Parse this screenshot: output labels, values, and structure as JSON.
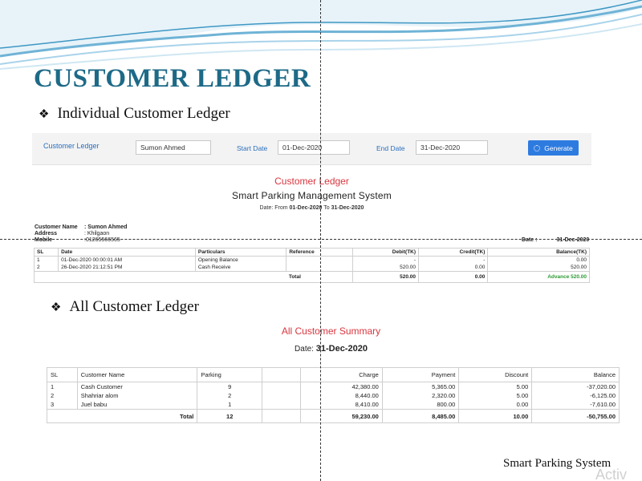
{
  "slide": {
    "title": "CUSTOMER LEDGER",
    "bullet1": "Individual Customer Ledger",
    "bullet2": "All Customer Ledger",
    "footer": "Smart Parking System",
    "watermark": "Activ"
  },
  "filter": {
    "title": "Customer Ledger",
    "customer_value": "Sumon Ahmed",
    "start_label": "Start Date",
    "start_value": "01-Dec-2020",
    "end_label": "End Date",
    "end_value": "31-Dec-2020",
    "generate_label": "Generate"
  },
  "ledger": {
    "title": "Customer Ledger",
    "system": "Smart Parking Management System",
    "date_prefix": "Date: From",
    "date_from": "01-Dec-2020",
    "date_to_word": "To",
    "date_to": "31-Dec-2020",
    "name_label": "Customer Name",
    "name_value": ": Sumon Ahmed",
    "address_label": "Address",
    "address_value": ": Khilgaon",
    "mobile_label": "Mobile",
    "mobile_value": ":01265566565",
    "report_date_label": "Date :",
    "report_date_value": "31-Dec-2020",
    "headers": [
      "SL",
      "Date",
      "Particulars",
      "Reference",
      "Debit(TK)",
      "Credit(TK)",
      "Balance(TK)"
    ],
    "rows": [
      {
        "sl": "1",
        "date": "01-Dec-2020 00:00:01 AM",
        "particulars": "Opening Balance",
        "reference": "",
        "debit": "-",
        "credit": "-",
        "balance": "0.00"
      },
      {
        "sl": "2",
        "date": "26-Dec-2020 21:12:51 PM",
        "particulars": "Cash Receive",
        "reference": "",
        "debit": "520.00",
        "credit": "0.00",
        "balance": "520.00"
      }
    ],
    "total_label": "Total",
    "total_debit": "520.00",
    "total_credit": "0.00",
    "total_balance": "Advance 520.00"
  },
  "summary": {
    "title": "All Customer Summary",
    "date_label": "Date:",
    "date_value": "31-Dec-2020",
    "headers": [
      "SL",
      "Customer Name",
      "Parking",
      "",
      "Charge",
      "Payment",
      "Discount",
      "Balance"
    ],
    "rows": [
      {
        "sl": "1",
        "name": "Cash Customer",
        "parking": "9",
        "charge": "42,380.00",
        "payment": "5,365.00",
        "discount": "5.00",
        "balance": "-37,020.00"
      },
      {
        "sl": "2",
        "name": "Shahriar alom",
        "parking": "2",
        "charge": "8,440.00",
        "payment": "2,320.00",
        "discount": "5.00",
        "balance": "-6,125.00"
      },
      {
        "sl": "3",
        "name": "Juel babu",
        "parking": "1",
        "charge": "8,410.00",
        "payment": "800.00",
        "discount": "0.00",
        "balance": "-7,610.00"
      }
    ],
    "total_label": "Total",
    "total_parking": "12",
    "total_charge": "59,230.00",
    "total_payment": "8,485.00",
    "total_discount": "10.00",
    "total_balance": "-50,755.00"
  },
  "colors": {
    "title": "#1d6a87",
    "report_red": "#d9363e",
    "link_blue": "#2a6ebb",
    "button_blue": "#2e7be0",
    "advance_green": "#2e9a34"
  }
}
